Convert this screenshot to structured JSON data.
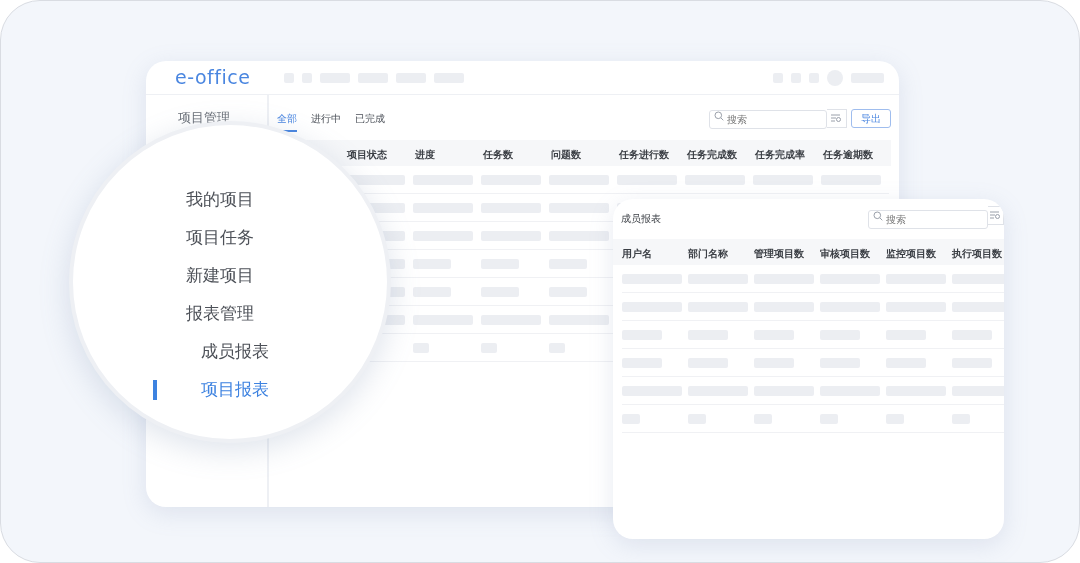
{
  "main_window": {
    "logo": "e-office",
    "sidebar": {
      "title": "项目管理"
    },
    "tabs": [
      {
        "label": "全部",
        "selected": true
      },
      {
        "label": "进行中",
        "selected": false
      },
      {
        "label": "已完成",
        "selected": false
      }
    ],
    "search": {
      "placeholder": "搜索"
    },
    "export_button": "导出",
    "table": {
      "columns": [
        "项目状态",
        "进度",
        "任务数",
        "问题数",
        "任务进行数",
        "任务完成数",
        "任务完成率",
        "任务逾期数"
      ]
    }
  },
  "magnifier": {
    "items": [
      {
        "label": "我的项目",
        "selected": false
      },
      {
        "label": "项目任务",
        "selected": false
      },
      {
        "label": "新建项目",
        "selected": false
      },
      {
        "label": "报表管理",
        "selected": false,
        "children": [
          {
            "label": "成员报表",
            "selected": false
          },
          {
            "label": "项目报表",
            "selected": true
          }
        ]
      }
    ]
  },
  "report_window": {
    "title": "成员报表",
    "search": {
      "placeholder": "搜索"
    },
    "table": {
      "columns": [
        "用户名",
        "部门名称",
        "管理项目数",
        "审核项目数",
        "监控项目数",
        "执行项目数"
      ]
    }
  }
}
